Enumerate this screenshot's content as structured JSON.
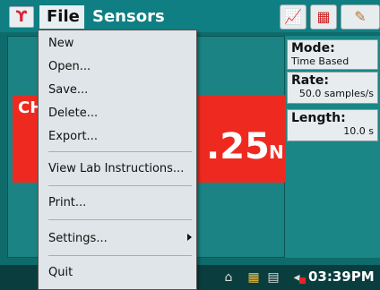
{
  "topbar": {
    "logo_glyph": "ϒ",
    "file_menu": "File",
    "sensors_menu": "Sensors",
    "icons": [
      "graph-icon",
      "table-icon",
      "more-icon"
    ]
  },
  "meter": {
    "label": "CH",
    "value": ".25",
    "unit": "N"
  },
  "info": {
    "mode_title": "Mode:",
    "mode_value": "Time Based",
    "rate_title": "Rate:",
    "rate_value": "50.0 samples/s",
    "length_title": "Length:",
    "length_value": "10.0 s"
  },
  "menu": {
    "new": "New",
    "open": "Open...",
    "save": "Save...",
    "delete": "Delete...",
    "export": "Export...",
    "view_lab": "View Lab Instructions...",
    "print": "Print...",
    "settings": "Settings...",
    "quit": "Quit"
  },
  "taskbar": {
    "clock": "03:39PM"
  }
}
